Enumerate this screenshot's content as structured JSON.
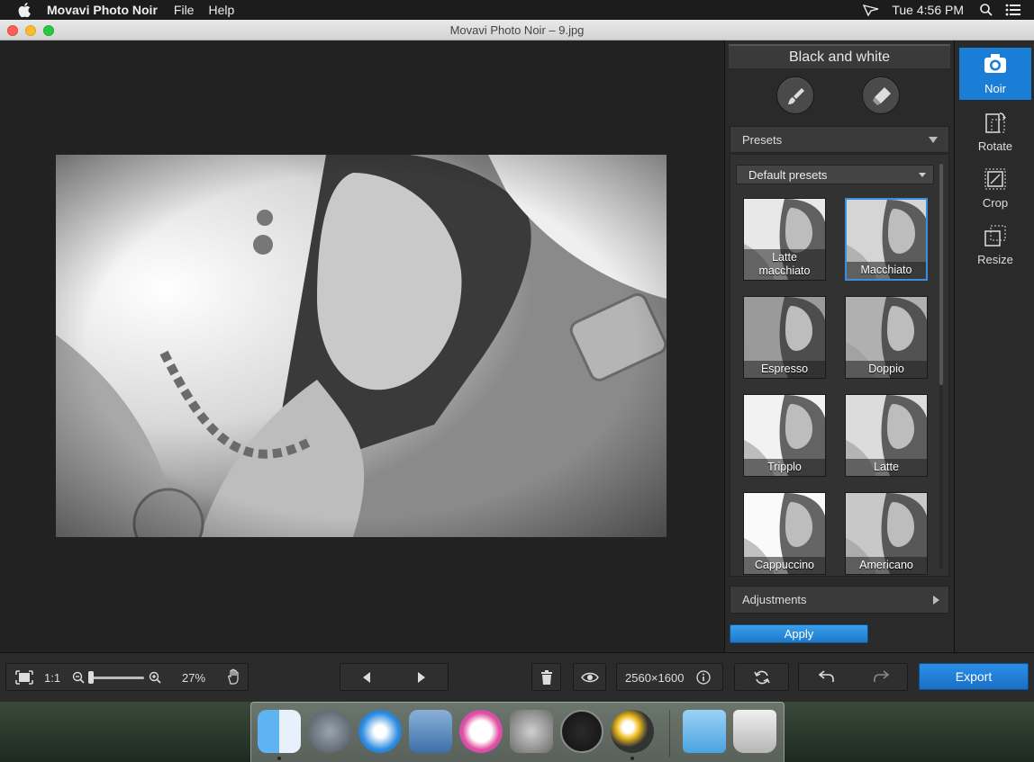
{
  "menubar": {
    "app_name": "Movavi Photo Noir",
    "menus": [
      "File",
      "Help"
    ],
    "clock": "Tue 4:56 PM"
  },
  "window": {
    "title": "Movavi Photo Noir – 9.jpg"
  },
  "panel": {
    "title": "Black and white",
    "presets_label": "Presets",
    "dropdown_value": "Default presets",
    "presets": [
      {
        "label": "Latte\nmacchiato",
        "selected": false
      },
      {
        "label": "Macchiato",
        "selected": true
      },
      {
        "label": "Espresso",
        "selected": false
      },
      {
        "label": "Doppio",
        "selected": false
      },
      {
        "label": "Tripplo",
        "selected": false
      },
      {
        "label": "Latte",
        "selected": false
      },
      {
        "label": "Cappuccino",
        "selected": false
      },
      {
        "label": "Americano",
        "selected": false
      }
    ],
    "adjustments_label": "Adjustments",
    "apply_label": "Apply"
  },
  "sidetools": [
    {
      "label": "Noir",
      "icon": "noir-camera-icon",
      "active": true
    },
    {
      "label": "Rotate",
      "icon": "rotate-icon",
      "active": false
    },
    {
      "label": "Crop",
      "icon": "crop-icon",
      "active": false
    },
    {
      "label": "Resize",
      "icon": "resize-icon",
      "active": false
    }
  ],
  "toolbar": {
    "one_to_one": "1:1",
    "zoom_percent": "27%",
    "image_size": "2560×1600",
    "export_label": "Export"
  },
  "colors": {
    "accent": "#1b7ed6",
    "panel_bg": "#2a2a2a",
    "canvas_bg": "#222222"
  }
}
